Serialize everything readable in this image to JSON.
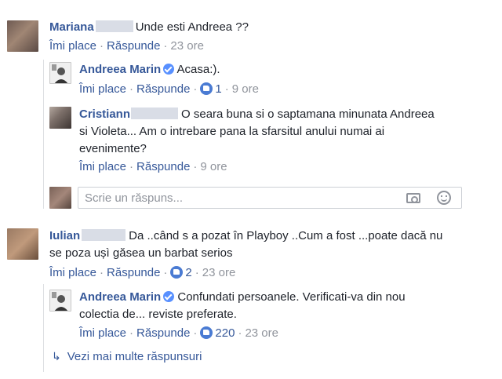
{
  "comments": [
    {
      "author": "Mariana",
      "text": "Unde esti Andreea ??",
      "like_label": "Îmi place",
      "reply_label": "Răspunde",
      "time": "23 ore"
    },
    {
      "author": "Andreea Marin",
      "text": "Acasa:).",
      "like_label": "Îmi place",
      "reply_label": "Răspunde",
      "likes": "1",
      "time": "9 ore"
    },
    {
      "author": "Cristiann",
      "text_line1": "O seara buna si o saptamana minunata Andreea",
      "text_line2": "si Violeta... Am o intrebare pana la sfarsitul anului numai ai",
      "text_line3": "evenimente?",
      "like_label": "Îmi place",
      "reply_label": "Răspunde",
      "time": "9 ore"
    },
    {
      "author": "Iulian",
      "text_line1": "Da ..când s a pozat în Playboy ..Cum a fost ...poate dacă nu",
      "text_line2": "se poza ușì găsea un barbat serios",
      "like_label": "Îmi place",
      "reply_label": "Răspunde",
      "likes": "2",
      "time": "23 ore"
    },
    {
      "author": "Andreea Marin",
      "text_line1": "Confundati persoanele. Verificati-va din nou",
      "text_line2": "colectia de... reviste preferate.",
      "like_label": "Îmi place",
      "reply_label": "Răspunde",
      "likes": "220",
      "time": "23 ore"
    }
  ],
  "reply_input": {
    "placeholder": "Scrie un răspuns..."
  },
  "more_replies": "Vezi mai multe răspunsuri",
  "icons": {
    "like": "thumbs-up-icon",
    "verified": "verified-badge-icon",
    "camera": "camera-icon",
    "emoji": "smiley-icon",
    "reply_arrow": "reply-arrow-icon"
  },
  "colors": {
    "link": "#365899",
    "muted": "#90949c",
    "like_badge": "#4a7bd3",
    "verified": "#5890ff"
  }
}
